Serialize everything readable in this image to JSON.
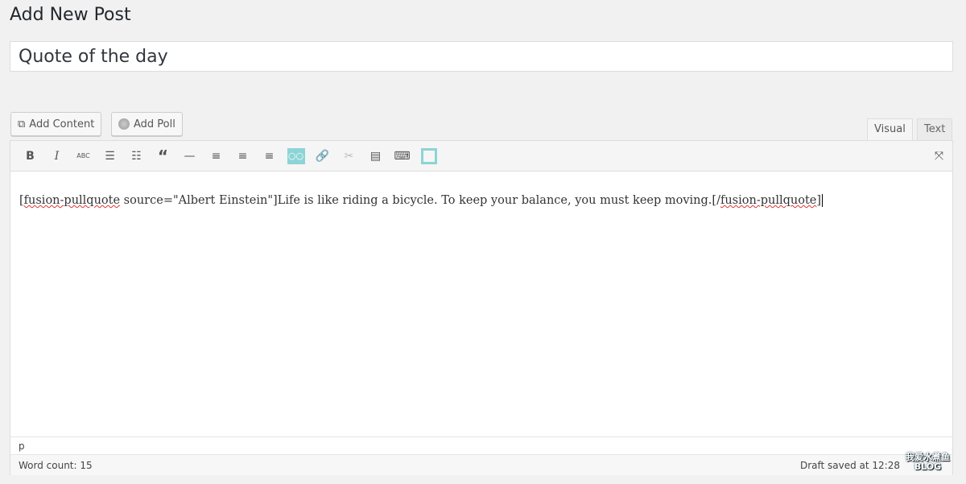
{
  "page_title": "Add New Post",
  "post_title": "Quote of the day",
  "media_buttons": [
    {
      "label": "Add Content",
      "icon": "add-content-icon"
    },
    {
      "label": "Add Poll",
      "icon": "poll-icon"
    }
  ],
  "tabs": [
    {
      "label": "Visual",
      "active": true
    },
    {
      "label": "Text",
      "active": false
    }
  ],
  "toolbar": [
    "bold",
    "italic",
    "strikethrough",
    "bullet-list",
    "numbered-list",
    "blockquote",
    "horizontal-rule",
    "align-left",
    "align-center",
    "align-right",
    "fusion-shortcode",
    "link",
    "unlink",
    "read-more",
    "toolbar-toggle",
    "layout"
  ],
  "accent": "#8dd4d6",
  "content": {
    "tag_open": "[fusion-pullquote",
    "mid": " source=\"Albert Einstein\"]Life is like riding a bicycle. To keep your balance, you must keep moving.[/",
    "tag_close": "fusion-pullquote",
    "end": "]"
  },
  "path": "p",
  "word_count": "Word count: 15",
  "draft_status": "Draft saved at 12:28",
  "watermark": {
    "line1": "我爱水煮鱼",
    "line2": "BLOG"
  }
}
